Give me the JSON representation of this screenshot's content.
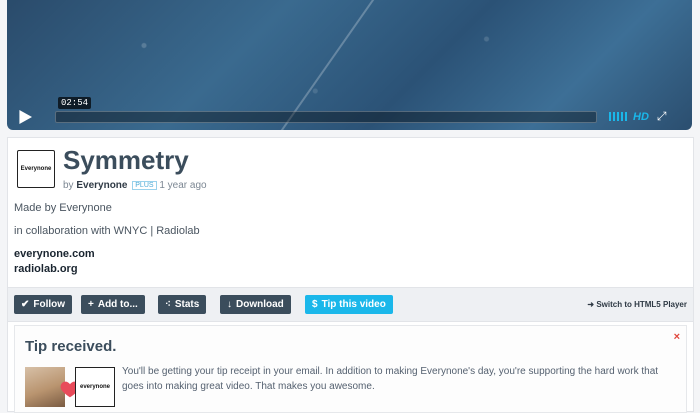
{
  "player": {
    "timecode": "02:54",
    "hd_label": "HD",
    "icons": {
      "play": "play-icon",
      "volume": "volume-icon",
      "fullscreen": "fullscreen-icon"
    }
  },
  "video": {
    "title": "Symmetry",
    "logo_text": "Everynone",
    "by_prefix": "by",
    "author": "Everynone",
    "badge": "PLUS",
    "age": "1 year ago",
    "description_line1": "Made by Everynone",
    "description_line2": "in collaboration with WNYC | Radiolab",
    "links": [
      "everynone.com",
      "radiolab.org"
    ]
  },
  "toolbar": {
    "follow": "Follow",
    "add_to": "Add to...",
    "stats": "Stats",
    "download": "Download",
    "tip": "Tip this video",
    "switch_player": "Switch to HTML5 Player"
  },
  "tip_notice": {
    "title": "Tip received.",
    "close": "×",
    "message": "You'll be getting your tip receipt in your email. In addition to making Everynone's day, you're supporting the hard work that goes into making great video. That makes you awesome.",
    "avatar_text": "everynone"
  },
  "colors": {
    "accent": "#1ab7ea",
    "button": "#3b4d5c",
    "close": "#e0443a"
  }
}
